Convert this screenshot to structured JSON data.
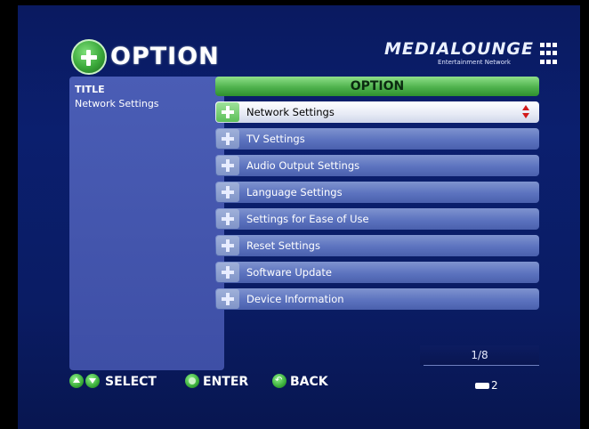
{
  "header": {
    "title": "OPTION",
    "icon": "plus-icon",
    "brand_name": "MEDIALOUNGE",
    "brand_sub": "Entertainment Network"
  },
  "left_panel": {
    "heading": "TITLE",
    "value": "Network Settings"
  },
  "options_panel": {
    "title": "OPTION",
    "items": [
      {
        "label": "Network Settings",
        "selected": true
      },
      {
        "label": "TV Settings"
      },
      {
        "label": "Audio Output Settings"
      },
      {
        "label": "Language Settings"
      },
      {
        "label": "Settings for Ease of Use"
      },
      {
        "label": "Reset Settings"
      },
      {
        "label": "Software Update"
      },
      {
        "label": "Device Information"
      }
    ],
    "page_indicator": "1/8"
  },
  "footer": {
    "select_label": "SELECT",
    "enter_label": "ENTER",
    "back_label": "BACK",
    "input_number": "2"
  },
  "colors": {
    "background": "#0a1c64",
    "accent_green": "#4fb24d",
    "item_blue": "#5c73bf",
    "scroll_red": "#d21a1a"
  }
}
